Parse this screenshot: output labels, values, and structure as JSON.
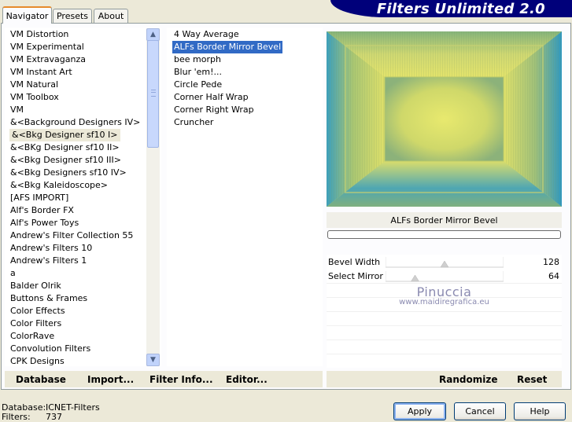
{
  "tabs": [
    {
      "label": "Navigator",
      "active": true
    },
    {
      "label": "Presets",
      "active": false
    },
    {
      "label": "About",
      "active": false
    }
  ],
  "app_title": "Filters Unlimited 2.0",
  "categories": [
    "VM Distortion",
    "VM Experimental",
    "VM Extravaganza",
    "VM Instant Art",
    "VM Natural",
    "VM Toolbox",
    "VM",
    "&<Background Designers IV>",
    "&<Bkg Designer sf10 I>",
    "&<BKg Designer sf10 II>",
    "&<Bkg Designer sf10 III>",
    "&<Bkg Designers sf10 IV>",
    "&<Bkg Kaleidoscope>",
    "[AFS IMPORT]",
    "Alf's Border FX",
    "Alf's Power Toys",
    "Andrew's Filter Collection 55",
    "Andrew's Filters 10",
    "Andrew's Filters 1",
    "a",
    "Balder Olrik",
    "Buttons & Frames",
    "Color Effects",
    "Color Filters",
    "ColorRave",
    "Convolution Filters",
    "CPK Designs"
  ],
  "selected_category_index": 8,
  "filters": [
    "4 Way Average",
    "ALFs Border Mirror Bevel",
    "bee morph",
    "Blur 'em!...",
    "Circle Pede",
    "Corner Half Wrap",
    "Corner Right Wrap",
    "Cruncher"
  ],
  "selected_filter_index": 1,
  "filter_name": "ALFs Border Mirror Bevel",
  "sliders": [
    {
      "label": "Bevel Width",
      "value": "128",
      "level": 0.5
    },
    {
      "label": "Select Mirror",
      "value": "64",
      "level": 0.25
    }
  ],
  "watermark": {
    "line1": "Pinuccia",
    "line2": "www.maidiregrafica.eu"
  },
  "bottom_links": {
    "database": "Database",
    "import": "Import...",
    "filter_info": "Filter Info...",
    "editor": "Editor...",
    "randomize": "Randomize",
    "reset": "Reset"
  },
  "status": {
    "database_label": "Database:",
    "database_value": "ICNET-Filters",
    "filters_label": "Filters:",
    "filters_value": "737"
  },
  "buttons": {
    "apply": "Apply",
    "cancel": "Cancel",
    "help": "Help"
  },
  "colors": {
    "banner": "#00007a",
    "selection": "#316ac5",
    "preview_yellow": "#e3e46a",
    "preview_teal": "#3fa3b5"
  }
}
